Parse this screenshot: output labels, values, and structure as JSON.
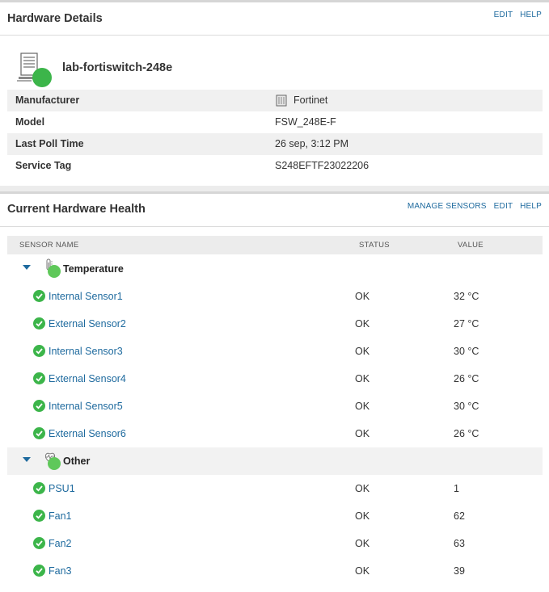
{
  "hardware_details": {
    "title": "Hardware Details",
    "links": {
      "edit": "EDIT",
      "help": "HELP"
    },
    "device_name": "lab-fortiswitch-248e",
    "device_status_color": "#3cb54a",
    "rows": [
      {
        "label": "Manufacturer",
        "value": "Fortinet",
        "icon": "vendor-icon"
      },
      {
        "label": "Model",
        "value": "FSW_248E-F"
      },
      {
        "label": "Last Poll Time",
        "value": "26 sep, 3:12 PM"
      },
      {
        "label": "Service Tag",
        "value": "S248EFTF23022206"
      }
    ]
  },
  "hardware_health": {
    "title": "Current Hardware Health",
    "links": {
      "manage_sensors": "MANAGE SENSORS",
      "edit": "EDIT",
      "help": "HELP"
    },
    "columns": {
      "name": "SENSOR NAME",
      "status": "STATUS",
      "value": "VALUE"
    },
    "groups": [
      {
        "label": "Temperature",
        "icon": "thermometer-icon",
        "sensors": [
          {
            "name": "Internal Sensor1",
            "status": "OK",
            "value": "32 °C"
          },
          {
            "name": "External Sensor2",
            "status": "OK",
            "value": "27 °C"
          },
          {
            "name": "Internal Sensor3",
            "status": "OK",
            "value": "30 °C"
          },
          {
            "name": "External Sensor4",
            "status": "OK",
            "value": "26 °C"
          },
          {
            "name": "Internal Sensor5",
            "status": "OK",
            "value": "30 °C"
          },
          {
            "name": "External Sensor6",
            "status": "OK",
            "value": "26 °C"
          }
        ]
      },
      {
        "label": "Other",
        "icon": "heart-monitor-icon",
        "sensors": [
          {
            "name": "PSU1",
            "status": "OK",
            "value": "1"
          },
          {
            "name": "Fan1",
            "status": "OK",
            "value": "62"
          },
          {
            "name": "Fan2",
            "status": "OK",
            "value": "63"
          },
          {
            "name": "Fan3",
            "status": "OK",
            "value": "39"
          }
        ]
      }
    ]
  },
  "colors": {
    "link": "#1e6a9e",
    "ok_green": "#3cb54a",
    "status_dot": "#5fc85a"
  }
}
